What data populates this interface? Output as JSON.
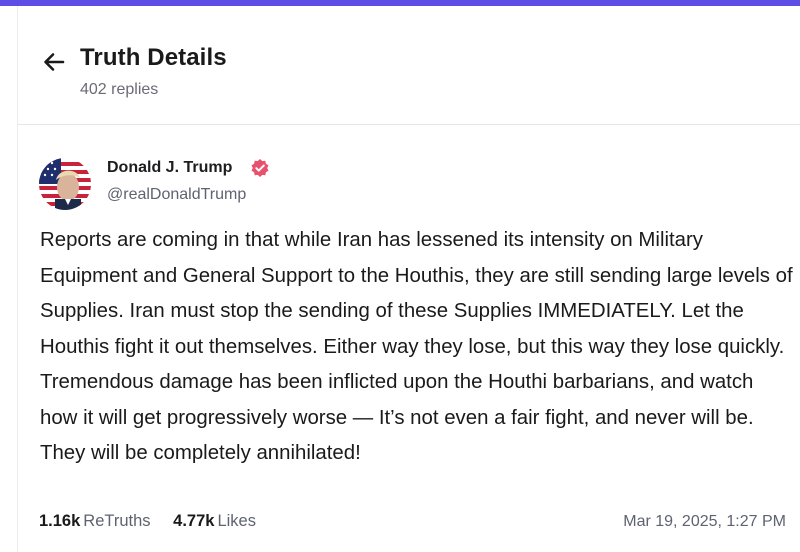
{
  "header": {
    "title": "Truth Details",
    "replies": "402 replies"
  },
  "post": {
    "author_name": "Donald J. Trump",
    "handle": "@realDonaldTrump",
    "body": "Reports are coming in that while Iran has lessened its intensity on Military Equipment and General Support to the Houthis, they are still sending large levels of Supplies. Iran must stop the sending of these Supplies IMMEDIATELY. Let the Houthis fight it out themselves. Either way they lose, but this way they lose quickly. Tremendous damage has been inflicted upon the Houthi barbarians, and watch how it will get progressively worse — It’s not even a fair fight, and never will be. They will be completely annihilated!",
    "retruths_count": "1.16k",
    "retruths_label": "ReTruths",
    "likes_count": "4.77k",
    "likes_label": "Likes",
    "timestamp": "Mar 19, 2025, 1:27 PM"
  },
  "icons": {
    "back": "arrow-left-icon",
    "verified": "verified-badge-icon"
  },
  "colors": {
    "accent_bar": "#5e4ee6",
    "verified_badge": "#e8506c",
    "text_primary": "#1a1a1a",
    "text_secondary": "#5f6371"
  }
}
